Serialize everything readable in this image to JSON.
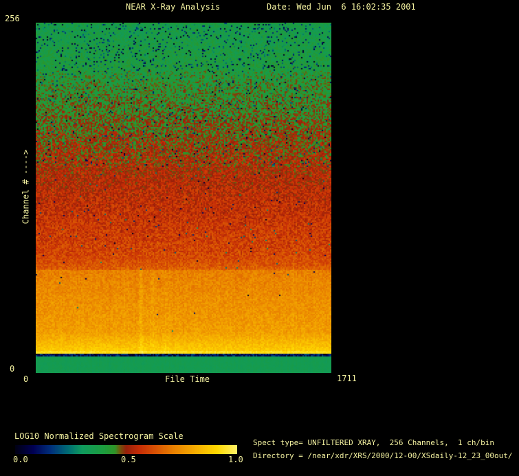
{
  "window": {
    "background": "#000000",
    "text_color": "#f3f1a0"
  },
  "header": {
    "title": "NEAR X-Ray Analysis",
    "date": "Date: Wed Jun  6 16:02:35 2001"
  },
  "plot": {
    "y_axis": {
      "max": "256",
      "min": "0",
      "label": "Channel # ---->"
    },
    "x_axis": {
      "min": "0",
      "max": "1711",
      "label": "File Time"
    }
  },
  "colorbar": {
    "title": "LOG10 Normalized Spectrogram Scale",
    "ticks": [
      "0.0",
      "0.5",
      "1.0"
    ]
  },
  "info": {
    "spect_type": "Spect type= UNFILTERED XRAY,  256 Channels,  1 ch/bin",
    "directory": "Directory = /near/xdr/XRS/2000/12-00/XSdaily-12_23_00out/"
  },
  "chart_data": {
    "type": "heatmap",
    "title": "NEAR X-Ray Analysis",
    "xlabel": "File Time",
    "ylabel": "Channel #",
    "xlim": [
      0,
      1711
    ],
    "ylim": [
      0,
      256
    ],
    "scale": {
      "label": "LOG10 Normalized Spectrogram Scale",
      "range": [
        0.0,
        1.0
      ]
    },
    "legend_position": "bottom-left",
    "grid": false,
    "colormap_stops": [
      [
        0.0,
        "#000014"
      ],
      [
        0.08,
        "#000052"
      ],
      [
        0.16,
        "#00307c"
      ],
      [
        0.24,
        "#006e74"
      ],
      [
        0.3,
        "#0f9a5e"
      ],
      [
        0.4,
        "#1d9c3e"
      ],
      [
        0.45,
        "#2f9428"
      ],
      [
        0.47,
        "#6e5c0e"
      ],
      [
        0.5,
        "#96200a"
      ],
      [
        0.56,
        "#c62d06"
      ],
      [
        0.63,
        "#d85104"
      ],
      [
        0.71,
        "#e87e00"
      ],
      [
        0.81,
        "#f5ac00"
      ],
      [
        0.91,
        "#ffd800"
      ],
      [
        1.0,
        "#fff266"
      ]
    ],
    "bands": [
      {
        "ch": [
          256.0,
          255.2
        ],
        "v": [
          0.4,
          0.4
        ],
        "noise": 0.015,
        "dark": 0.05,
        "note": "solid green top line"
      },
      {
        "ch": [
          255.2,
          221.0
        ],
        "v": [
          0.36,
          0.4
        ],
        "noise": 0.055,
        "dark": 0.1,
        "note": "green noise with dark blue/black speckles"
      },
      {
        "ch": [
          221.0,
          151.0
        ],
        "v": [
          0.4,
          0.52
        ],
        "noise": 0.075,
        "dark": 0.035,
        "note": "green-to-red speckled transition"
      },
      {
        "ch": [
          151.0,
          85.0
        ],
        "v": [
          0.52,
          0.61
        ],
        "noise": 0.065,
        "dark": 0.008,
        "note": "red zone with green specks"
      },
      {
        "ch": [
          85.0,
          75.5
        ],
        "v": [
          0.61,
          0.655
        ],
        "noise": 0.05,
        "dark": 0.003,
        "note": "red-orange ramp"
      },
      {
        "ch": [
          75.5,
          30.0
        ],
        "v": [
          0.715,
          0.78
        ],
        "noise": 0.045,
        "dark": 0.002,
        "note": "bright orange band"
      },
      {
        "ch": [
          30.0,
          16.5
        ],
        "v": [
          0.78,
          0.88
        ],
        "noise": 0.04,
        "dark": 0.0,
        "note": "orange brightening to yellow"
      },
      {
        "ch": [
          16.5,
          14.5
        ],
        "v": [
          0.93,
          0.93
        ],
        "noise": 0.03,
        "dark": 0.0,
        "note": "bright yellow row"
      },
      {
        "ch": [
          14.5,
          12.0
        ],
        "v": [
          0.1,
          0.1
        ],
        "noise": 0.1,
        "dark": 0.0,
        "note": "dark separator row"
      },
      {
        "ch": [
          12.0,
          0.0
        ],
        "v": [
          0.34,
          0.34
        ],
        "noise": 0.013,
        "dark": 0.0,
        "note": "uniform green bottom band"
      }
    ],
    "streaks": [
      {
        "x_frac": 0.355,
        "ch": [
          75.5,
          14.5
        ],
        "boost": 0.05
      },
      {
        "x_frac": 0.395,
        "ch": [
          75.5,
          14.5
        ],
        "boost": 0.03
      },
      {
        "x_frac": 0.44,
        "ch": [
          75.5,
          14.5
        ],
        "boost": 0.025
      }
    ]
  }
}
